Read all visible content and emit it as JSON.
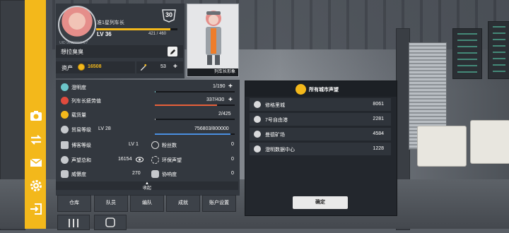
{
  "profile": {
    "rank_title": "准1星列车长",
    "level_badge": "30",
    "level": "LV 36",
    "xp": "421 / 460",
    "xp_progress": 0.915,
    "uid": "UID   90110016427",
    "name": "想拉臭臭",
    "assets_label": "资产",
    "coins": "16508",
    "fuel": "53"
  },
  "portrait": {
    "label": "列车长形象"
  },
  "stats": {
    "clarity": {
      "label": "澄明度",
      "value": "1/190",
      "progress": 0.005
    },
    "fatigue": {
      "label": "列车长疲劳值",
      "value": "337/430",
      "progress": 0.78
    },
    "cargo": {
      "label": "载货量",
      "value": "2/425",
      "progress": 0.005
    },
    "trade": {
      "label": "贸易等级",
      "level": "LV 28",
      "value": "756803/800000",
      "progress": 0.946
    },
    "expo_level": {
      "label": "博客等级",
      "value": "LV 1"
    },
    "fans": {
      "label": "粉丝数",
      "value": "0"
    },
    "reputation_total": {
      "label": "声望总和",
      "value": "16154"
    },
    "eco_rep": {
      "label": "环保声望",
      "value": "0"
    },
    "intimidation": {
      "label": "威慑度",
      "value": "270"
    },
    "resonance": {
      "label": "协响度",
      "value": "0"
    },
    "collapse": "收起"
  },
  "bottom_buttons": [
    "仓库",
    "队员",
    "编队",
    "成就",
    "账户设置"
  ],
  "popup": {
    "title": "所有城市声望",
    "cities": [
      {
        "name": "修格里城",
        "value": "8061"
      },
      {
        "name": "7号自由港",
        "value": "2281"
      },
      {
        "name": "曼德矿场",
        "value": "4584"
      },
      {
        "name": "澄明数据中心",
        "value": "1228"
      }
    ],
    "confirm": "确定"
  },
  "sidebar_icons": [
    "camera-icon",
    "transfer-icon",
    "mail-icon",
    "gear-icon",
    "logout-icon"
  ],
  "colors": {
    "accent": "#f3b81b",
    "panel": "#33383f",
    "fatigue": "#e8603a",
    "trade": "#4a8fe0"
  }
}
